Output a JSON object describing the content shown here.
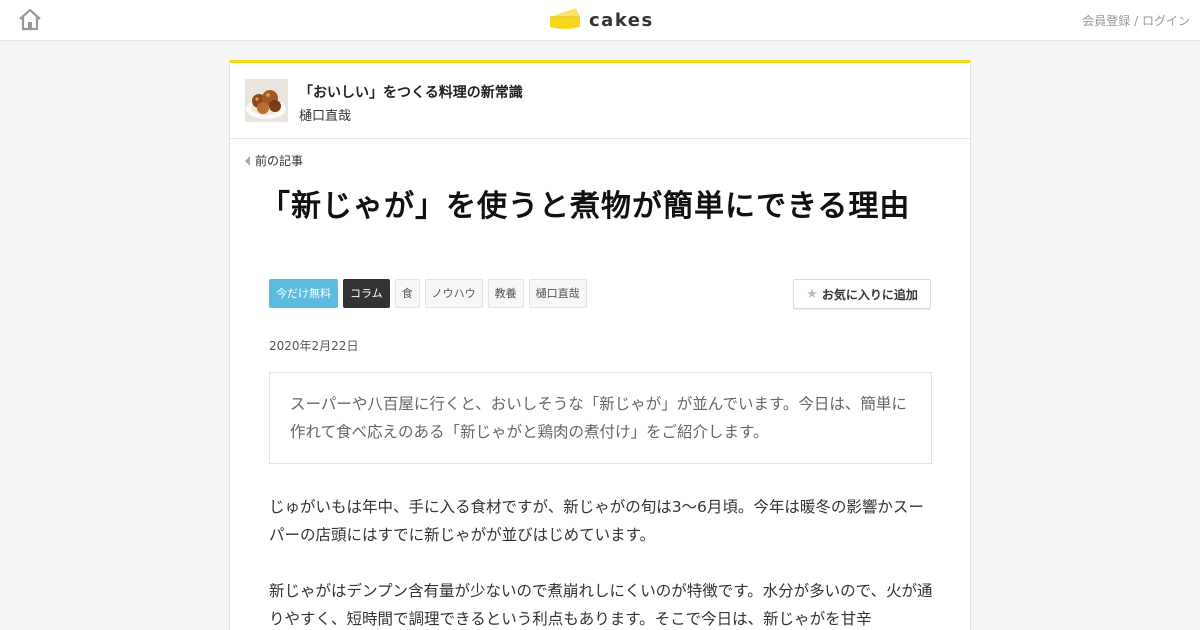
{
  "header": {
    "home_icon": "home-icon",
    "logo_text": "cakes",
    "logo_icon": "cheese-cake-icon",
    "auth_links": {
      "register": "会員登録",
      "separator": " / ",
      "login": "ログイン"
    }
  },
  "series": {
    "title": "「おいしい」をつくる料理の新常識",
    "author": "樋口直哉",
    "thumbnail_icon": "simmered-dish-thumbnail"
  },
  "nav": {
    "prev_label": "前の記事"
  },
  "article": {
    "title": "「新じゃが」を使うと煮物が簡単にできる理由",
    "tags": [
      "今だけ無料",
      "コラム",
      "食",
      "ノウハウ",
      "教養",
      "樋口直哉"
    ],
    "favorite_label": "お気に入りに追加",
    "date": "2020年2月22日",
    "lead": "スーパーや八百屋に行くと、おいしそうな「新じゃが」が並んでいます。今日は、簡単に作れて食べ応えのある「新じゃがと鶏肉の煮付け」をご紹介します。",
    "paragraphs": [
      "じゅがいもは年中、手に入る食材ですが、新じゃがの旬は3〜6月頃。今年は暖冬の影響かスーパーの店頭にはすでに新じゃがが並びはじめています。",
      "新じゃがはデンプン含有量が少ないので煮崩れしにくいのが特徴です。水分が多いので、火が通りやすく、短時間で調理できるという利点もあります。そこで今日は、新じゃがを甘辛"
    ]
  },
  "colors": {
    "accent_yellow": "#f9d71c",
    "tag_free": "#5bbcdf",
    "tag_column": "#333333"
  }
}
